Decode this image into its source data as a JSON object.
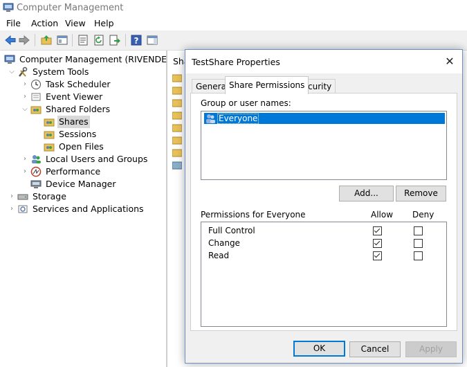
{
  "window": {
    "title": "Computer Management"
  },
  "menu": [
    "File",
    "Action",
    "View",
    "Help"
  ],
  "toolbar": {
    "icons": [
      "back-icon",
      "forward-icon",
      "up-folder-icon",
      "show-hide-tree-icon",
      "properties-icon",
      "refresh-icon",
      "export-icon",
      "help-icon",
      "action-pane-icon"
    ]
  },
  "tree": {
    "root": "Computer Management (RIVENDELL)",
    "system_tools": "System Tools",
    "task_scheduler": "Task Scheduler",
    "event_viewer": "Event Viewer",
    "shared_folders": "Shared Folders",
    "shares": "Shares",
    "sessions": "Sessions",
    "open_files": "Open Files",
    "local_users": "Local Users and Groups",
    "performance": "Performance",
    "device_manager": "Device Manager",
    "storage": "Storage",
    "services": "Services and Applications"
  },
  "right_pane": {
    "header": "Sha"
  },
  "dialog": {
    "title": "TestShare Properties",
    "close": "✕",
    "tabs": [
      "General",
      "Share Permissions",
      "Security"
    ],
    "group_label": "Group or user names:",
    "users": [
      "Everyone"
    ],
    "add_button": "Add...",
    "remove_button": "Remove",
    "perm_label": "Permissions for Everyone",
    "allow_header": "Allow",
    "deny_header": "Deny",
    "permissions": [
      {
        "name": "Full Control",
        "allow": true,
        "deny": false
      },
      {
        "name": "Change",
        "allow": true,
        "deny": false
      },
      {
        "name": "Read",
        "allow": true,
        "deny": false
      }
    ],
    "ok": "OK",
    "cancel": "Cancel",
    "apply": "Apply"
  }
}
